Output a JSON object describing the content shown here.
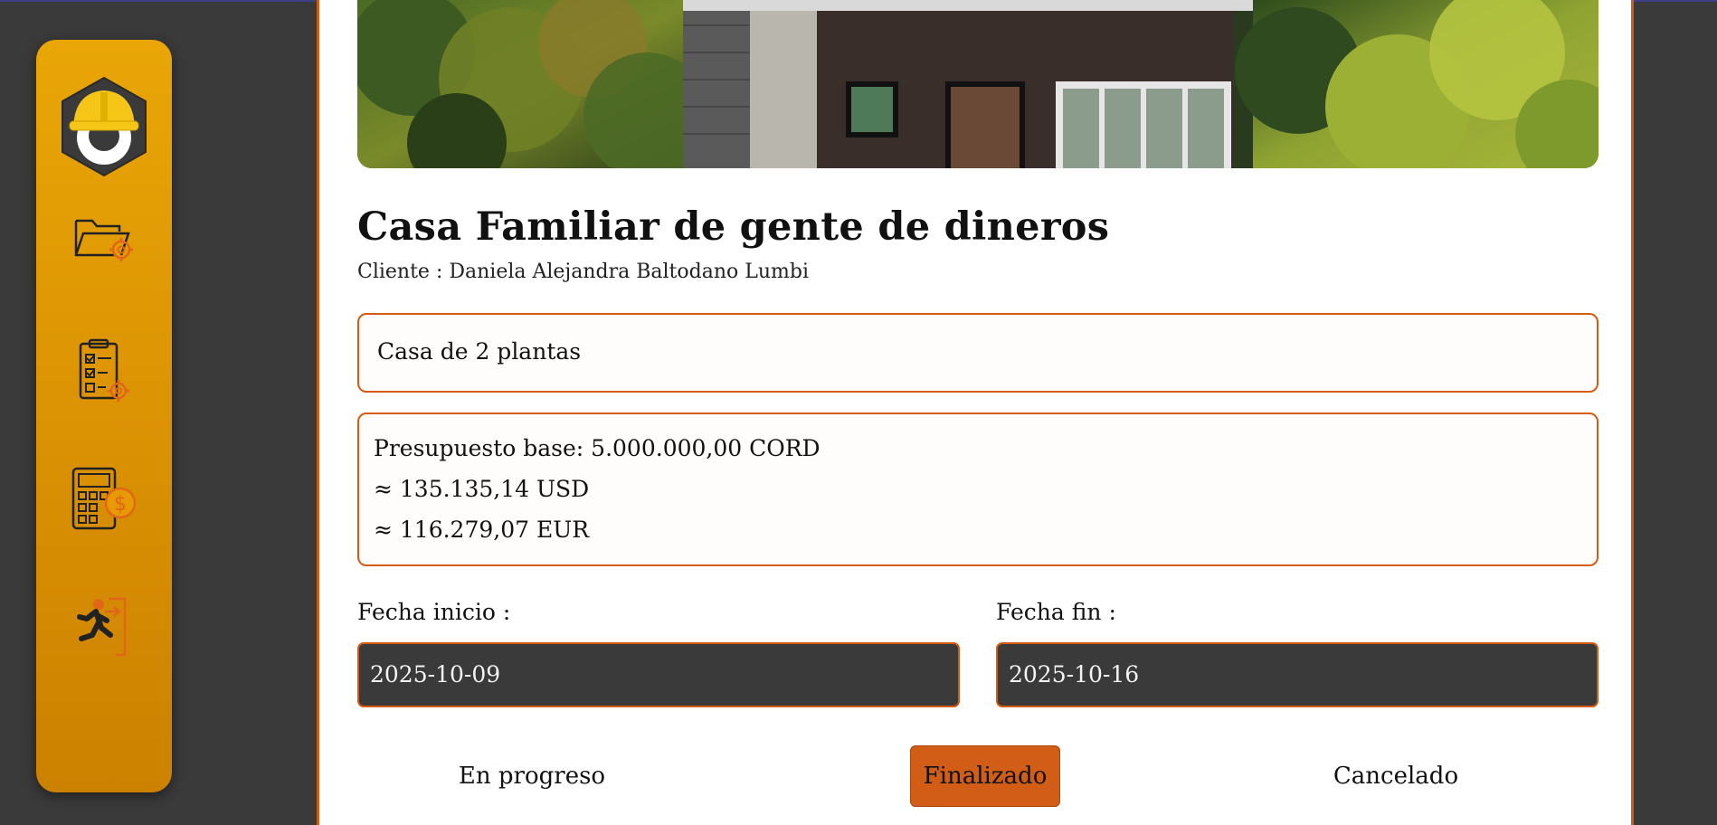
{
  "project": {
    "title": "Casa Familiar de gente de dineros",
    "client_line": "Cliente : Daniela Alejandra Baltodano Lumbi",
    "description": "Casa de 2 plantas",
    "budget": {
      "base": "Presupuesto base: 5.000.000,00 CORD",
      "usd": "≈ 135.135,14 USD",
      "eur": "≈ 116.279,07 EUR"
    },
    "dates": {
      "start_label": "Fecha inicio :",
      "start_value": "2025-10-09",
      "end_label": "Fecha fin :",
      "end_value": "2025-10-16"
    },
    "status_options": [
      {
        "label": "En progreso",
        "selected": false
      },
      {
        "label": "Finalizado",
        "selected": true
      },
      {
        "label": "Cancelado",
        "selected": false
      }
    ]
  },
  "sidebar": {
    "items": [
      {
        "icon": "helmet-logo-icon"
      },
      {
        "icon": "folder-settings-icon"
      },
      {
        "icon": "clipboard-settings-icon"
      },
      {
        "icon": "calculator-money-icon"
      },
      {
        "icon": "exit-runner-icon"
      }
    ]
  },
  "colors": {
    "accent": "#d55a14",
    "sidebar": "#e0a006",
    "background": "#3a3a3a",
    "input_bg": "#3a3a3a"
  }
}
